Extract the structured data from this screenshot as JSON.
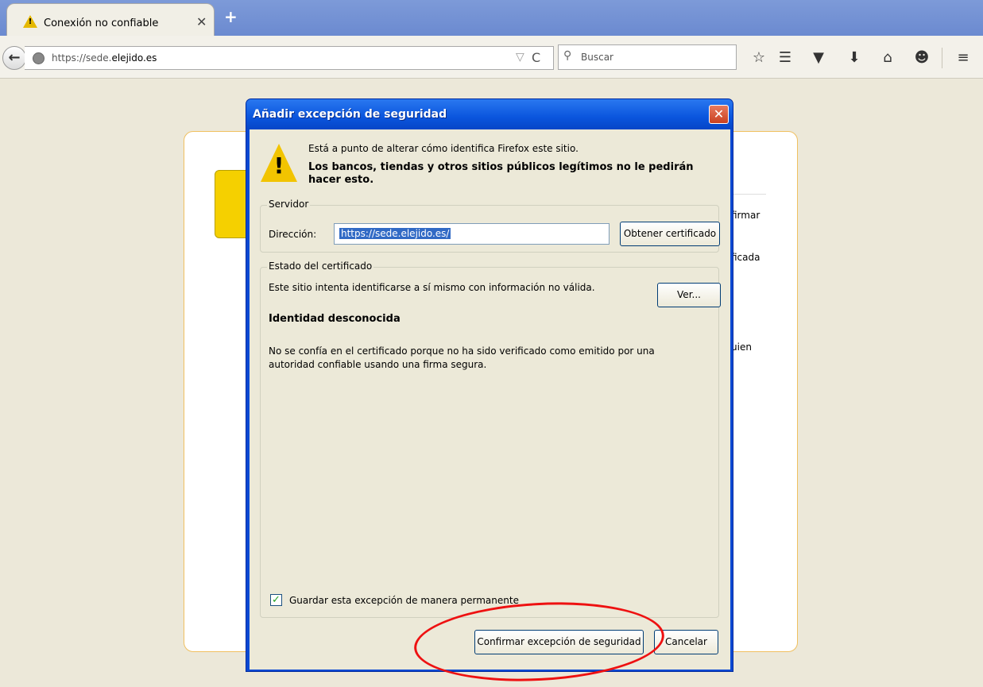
{
  "tab": {
    "title": "Conexión no confiable",
    "warning_mark": "!",
    "close": "✕",
    "new_tab": "+"
  },
  "navbar": {
    "back": "←",
    "url_prefix": "https://sede.",
    "url_domain": "elejido.es",
    "dropdown": "▽",
    "reload": "C",
    "search_placeholder": "Buscar",
    "search_glyph": "⚲",
    "icons": {
      "bookmark_star": "☆",
      "reading_list": "☰",
      "pocket": "▼",
      "download": "⬇",
      "home": "⌂",
      "hello": "☻",
      "menu": "≡"
    }
  },
  "page_background": {
    "fragments": [
      "firmar",
      "ficada",
      "uien"
    ]
  },
  "dialog": {
    "title": "Añadir excepción de seguridad",
    "close_glyph": "✕",
    "warning_mark": "!",
    "message_line1": "Está a punto de alterar cómo identifica Firefox este sitio.",
    "message_line2": "Los bancos, tiendas y otros sitios públicos legítimos no le pedirán hacer esto.",
    "server": {
      "legend": "Servidor",
      "address_label": "Dirección:",
      "address_value": "https://sede.elejido.es/",
      "get_cert_button": "Obtener certificado"
    },
    "status": {
      "legend": "Estado del certificado",
      "status_text": "Este sitio intenta identificarse a sí mismo con información no válida.",
      "view_button": "Ver...",
      "identity_heading": "Identidad desconocida",
      "description": "No se confía en el certificado porque no ha sido verificado como emitido por una autoridad confiable usando una firma segura.",
      "permanent_checkbox_label": "Guardar esta excepción de manera permanente",
      "permanent_checked": true,
      "check_glyph": "✓"
    },
    "confirm_button": "Confirmar excepción de seguridad",
    "cancel_button": "Cancelar"
  },
  "colors": {
    "dialog_title_blue": "#0a55dd",
    "highlight_ellipse": "#ee1111",
    "warning_yellow": "#f2c400"
  }
}
